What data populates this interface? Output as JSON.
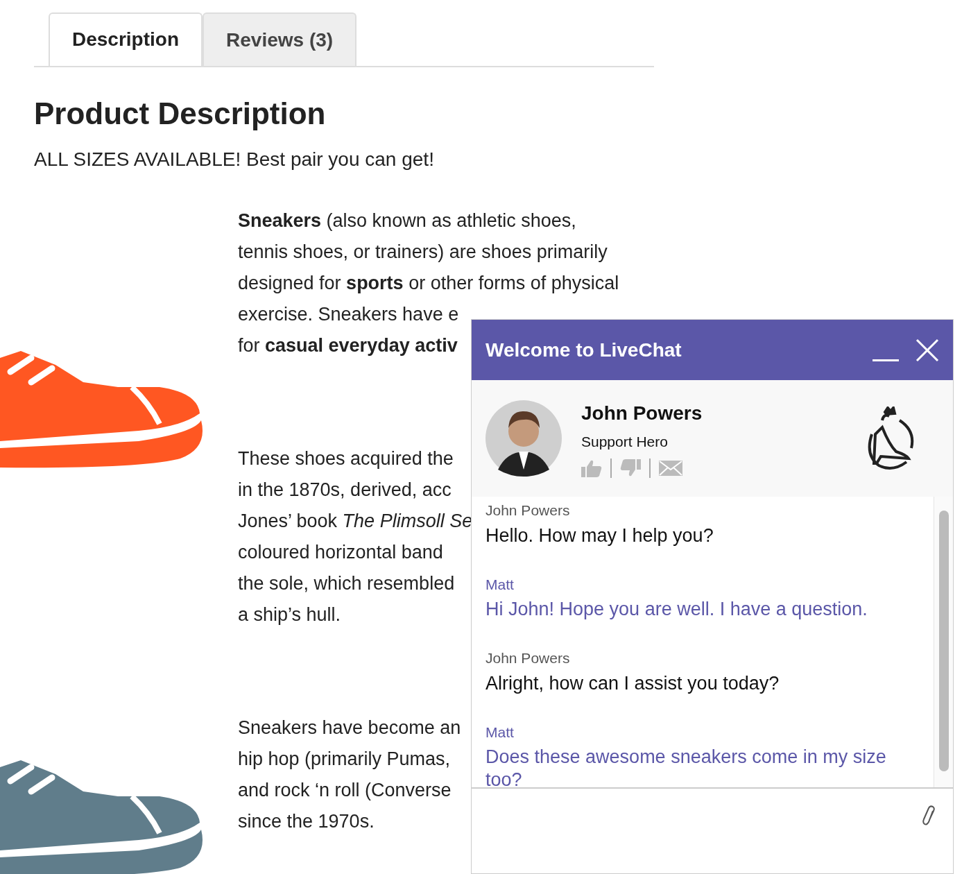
{
  "tabs": [
    {
      "label": "Description",
      "selected": true
    },
    {
      "label": "Reviews (3)",
      "selected": false
    }
  ],
  "heading": "Product Description",
  "tagline": "ALL SIZES AVAILABLE! Best pair you can get!",
  "paragraphs": [
    {
      "lines": [
        "**Sneakers** (also known as athletic shoes,",
        "tennis shoes, or trainers) are shoes primarily",
        "designed for **sports** or other forms of physical",
        "exercise. Sneakers have e",
        "for **casual everyday activ**"
      ]
    },
    {
      "lines": [
        "These shoes acquired the",
        "in the 1870s, derived, acc",
        "Jones’ book *The Plimsoll Se*",
        "coloured horizontal band",
        "the sole, which resembled",
        "a ship’s hull."
      ]
    },
    {
      "lines": [
        "Sneakers have become an",
        "hip hop (primarily Pumas,",
        "and rock ‘n roll (Converse",
        "since the 1970s."
      ]
    }
  ],
  "shoes": [
    {
      "color": "#ff5722"
    },
    {
      "color": "#607d8b"
    }
  ],
  "chat": {
    "title": "Welcome to LiveChat",
    "agent": {
      "name": "John Powers",
      "role": "Support Hero"
    },
    "messages": [
      {
        "author": "John Powers",
        "text": "Hello. How may I help you?",
        "from_visitor": false
      },
      {
        "author": "Matt",
        "text": "Hi John! Hope you are well. I have a question.",
        "from_visitor": true
      },
      {
        "author": "John Powers",
        "text": "Alright, how can I assist you today?",
        "from_visitor": false
      },
      {
        "author": "Matt",
        "text": "Does these awesome sneakers come in my size too?",
        "from_visitor": true
      }
    ]
  }
}
